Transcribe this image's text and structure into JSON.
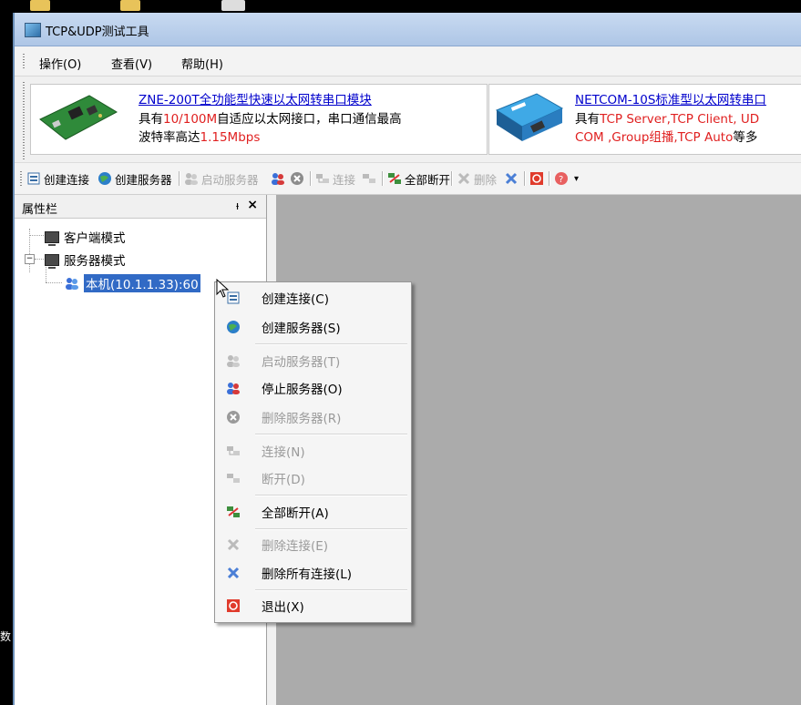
{
  "window": {
    "title": "TCP&UDP测试工具"
  },
  "menu": {
    "items": [
      "操作(O)",
      "查看(V)",
      "帮助(H)"
    ]
  },
  "ads": [
    {
      "title": "ZNE-200T全功能型快速以太网转串口模块",
      "line1_a": "具有",
      "line1_red": "10/100M",
      "line1_b": "自适应以太网接口，串口通信最高",
      "line2_a": "波特率高达",
      "line2_red": "1.15Mbps"
    },
    {
      "title": "NETCOM-10S标准型以太网转串口",
      "line1_a": "具有",
      "line1_red": "TCP Server,TCP Client, UD",
      "line2_red": "COM ,Group组播,TCP Auto",
      "line2_b": "等多"
    }
  ],
  "toolbar": {
    "create_connection": "创建连接",
    "create_server": "创建服务器",
    "start_server": "启动服务器",
    "connect": "连接",
    "disconnect_all": "全部断开",
    "delete": "删除"
  },
  "panel": {
    "title": "属性栏",
    "pin": "ᵼ",
    "close": "×",
    "client_mode": "客户端模式",
    "server_mode": "服务器模式",
    "local_server": "本机(10.1.1.33):60"
  },
  "context_menu": {
    "create_connection": "创建连接(C)",
    "create_server": "创建服务器(S)",
    "start_server": "启动服务器(T)",
    "stop_server": "停止服务器(O)",
    "delete_server": "删除服务器(R)",
    "connect": "连接(N)",
    "disconnect": "断开(D)",
    "disconnect_all": "全部断开(A)",
    "delete_connection": "删除连接(E)",
    "delete_all_connections": "删除所有连接(L)",
    "exit": "退出(X)"
  },
  "desktop": {
    "left_text": "数"
  },
  "colors": {
    "selection": "#316ac5",
    "workspace": "#ababab",
    "ad_link": "#0000cc",
    "ad_highlight": "#e02020"
  }
}
